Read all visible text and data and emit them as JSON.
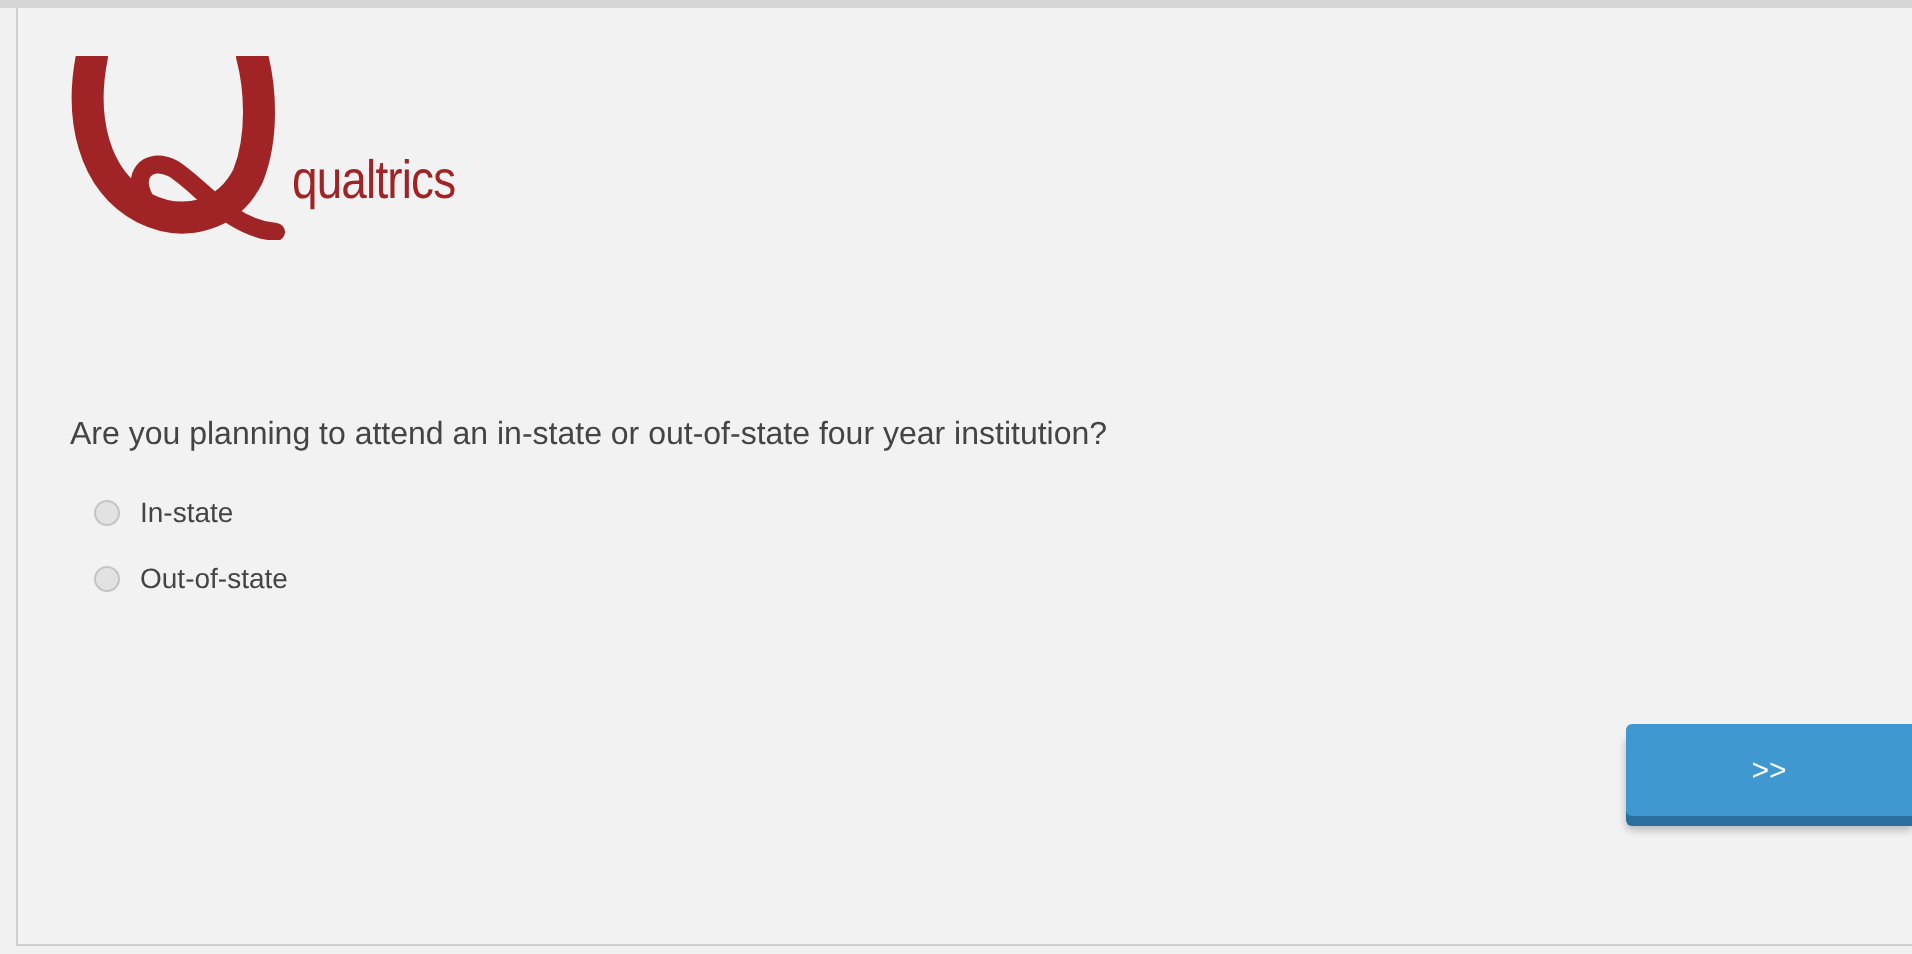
{
  "logo": {
    "text": "qualtrics"
  },
  "question": {
    "text": "Are you planning to attend an in-state or out-of-state four year institution?",
    "options": [
      {
        "label": "In-state",
        "selected": false
      },
      {
        "label": "Out-of-state",
        "selected": false
      }
    ]
  },
  "next_button": {
    "label": ">>"
  }
}
